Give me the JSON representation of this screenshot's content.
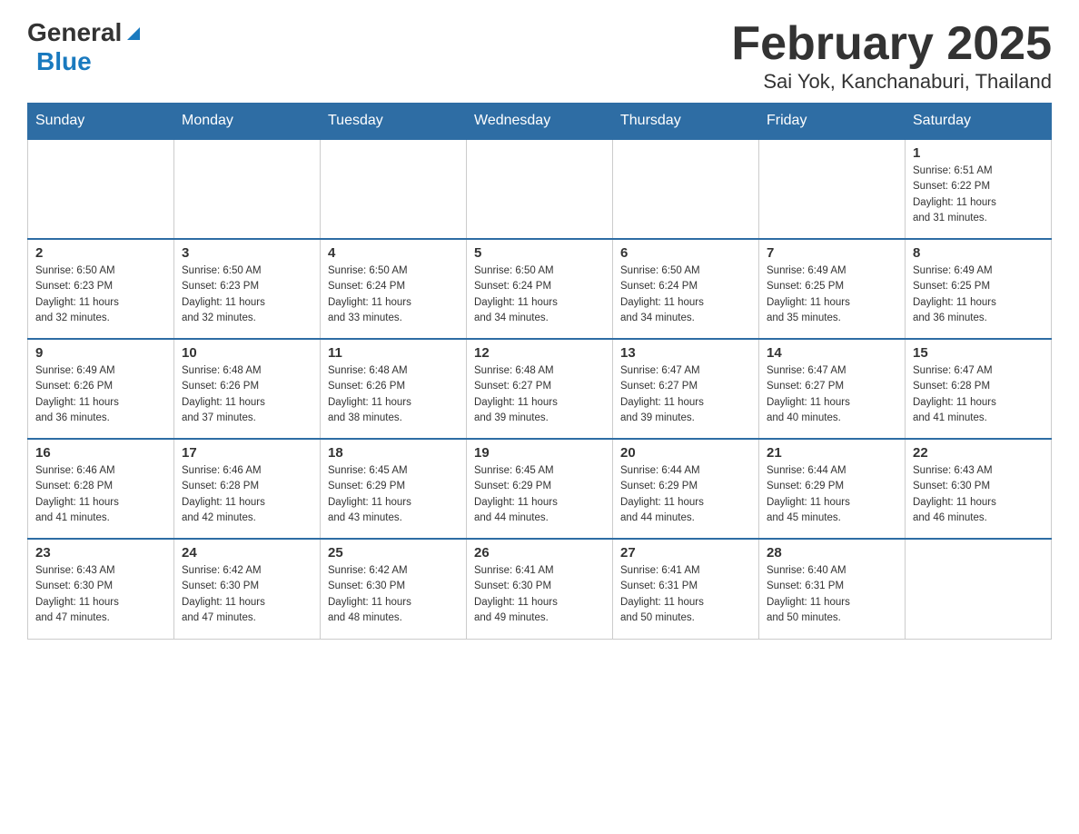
{
  "header": {
    "logo_general": "General",
    "logo_blue": "Blue",
    "title": "February 2025",
    "subtitle": "Sai Yok, Kanchanaburi, Thailand"
  },
  "weekdays": [
    "Sunday",
    "Monday",
    "Tuesday",
    "Wednesday",
    "Thursday",
    "Friday",
    "Saturday"
  ],
  "weeks": [
    [
      {
        "day": "",
        "info": ""
      },
      {
        "day": "",
        "info": ""
      },
      {
        "day": "",
        "info": ""
      },
      {
        "day": "",
        "info": ""
      },
      {
        "day": "",
        "info": ""
      },
      {
        "day": "",
        "info": ""
      },
      {
        "day": "1",
        "info": "Sunrise: 6:51 AM\nSunset: 6:22 PM\nDaylight: 11 hours\nand 31 minutes."
      }
    ],
    [
      {
        "day": "2",
        "info": "Sunrise: 6:50 AM\nSunset: 6:23 PM\nDaylight: 11 hours\nand 32 minutes."
      },
      {
        "day": "3",
        "info": "Sunrise: 6:50 AM\nSunset: 6:23 PM\nDaylight: 11 hours\nand 32 minutes."
      },
      {
        "day": "4",
        "info": "Sunrise: 6:50 AM\nSunset: 6:24 PM\nDaylight: 11 hours\nand 33 minutes."
      },
      {
        "day": "5",
        "info": "Sunrise: 6:50 AM\nSunset: 6:24 PM\nDaylight: 11 hours\nand 34 minutes."
      },
      {
        "day": "6",
        "info": "Sunrise: 6:50 AM\nSunset: 6:24 PM\nDaylight: 11 hours\nand 34 minutes."
      },
      {
        "day": "7",
        "info": "Sunrise: 6:49 AM\nSunset: 6:25 PM\nDaylight: 11 hours\nand 35 minutes."
      },
      {
        "day": "8",
        "info": "Sunrise: 6:49 AM\nSunset: 6:25 PM\nDaylight: 11 hours\nand 36 minutes."
      }
    ],
    [
      {
        "day": "9",
        "info": "Sunrise: 6:49 AM\nSunset: 6:26 PM\nDaylight: 11 hours\nand 36 minutes."
      },
      {
        "day": "10",
        "info": "Sunrise: 6:48 AM\nSunset: 6:26 PM\nDaylight: 11 hours\nand 37 minutes."
      },
      {
        "day": "11",
        "info": "Sunrise: 6:48 AM\nSunset: 6:26 PM\nDaylight: 11 hours\nand 38 minutes."
      },
      {
        "day": "12",
        "info": "Sunrise: 6:48 AM\nSunset: 6:27 PM\nDaylight: 11 hours\nand 39 minutes."
      },
      {
        "day": "13",
        "info": "Sunrise: 6:47 AM\nSunset: 6:27 PM\nDaylight: 11 hours\nand 39 minutes."
      },
      {
        "day": "14",
        "info": "Sunrise: 6:47 AM\nSunset: 6:27 PM\nDaylight: 11 hours\nand 40 minutes."
      },
      {
        "day": "15",
        "info": "Sunrise: 6:47 AM\nSunset: 6:28 PM\nDaylight: 11 hours\nand 41 minutes."
      }
    ],
    [
      {
        "day": "16",
        "info": "Sunrise: 6:46 AM\nSunset: 6:28 PM\nDaylight: 11 hours\nand 41 minutes."
      },
      {
        "day": "17",
        "info": "Sunrise: 6:46 AM\nSunset: 6:28 PM\nDaylight: 11 hours\nand 42 minutes."
      },
      {
        "day": "18",
        "info": "Sunrise: 6:45 AM\nSunset: 6:29 PM\nDaylight: 11 hours\nand 43 minutes."
      },
      {
        "day": "19",
        "info": "Sunrise: 6:45 AM\nSunset: 6:29 PM\nDaylight: 11 hours\nand 44 minutes."
      },
      {
        "day": "20",
        "info": "Sunrise: 6:44 AM\nSunset: 6:29 PM\nDaylight: 11 hours\nand 44 minutes."
      },
      {
        "day": "21",
        "info": "Sunrise: 6:44 AM\nSunset: 6:29 PM\nDaylight: 11 hours\nand 45 minutes."
      },
      {
        "day": "22",
        "info": "Sunrise: 6:43 AM\nSunset: 6:30 PM\nDaylight: 11 hours\nand 46 minutes."
      }
    ],
    [
      {
        "day": "23",
        "info": "Sunrise: 6:43 AM\nSunset: 6:30 PM\nDaylight: 11 hours\nand 47 minutes."
      },
      {
        "day": "24",
        "info": "Sunrise: 6:42 AM\nSunset: 6:30 PM\nDaylight: 11 hours\nand 47 minutes."
      },
      {
        "day": "25",
        "info": "Sunrise: 6:42 AM\nSunset: 6:30 PM\nDaylight: 11 hours\nand 48 minutes."
      },
      {
        "day": "26",
        "info": "Sunrise: 6:41 AM\nSunset: 6:30 PM\nDaylight: 11 hours\nand 49 minutes."
      },
      {
        "day": "27",
        "info": "Sunrise: 6:41 AM\nSunset: 6:31 PM\nDaylight: 11 hours\nand 50 minutes."
      },
      {
        "day": "28",
        "info": "Sunrise: 6:40 AM\nSunset: 6:31 PM\nDaylight: 11 hours\nand 50 minutes."
      },
      {
        "day": "",
        "info": ""
      }
    ]
  ]
}
